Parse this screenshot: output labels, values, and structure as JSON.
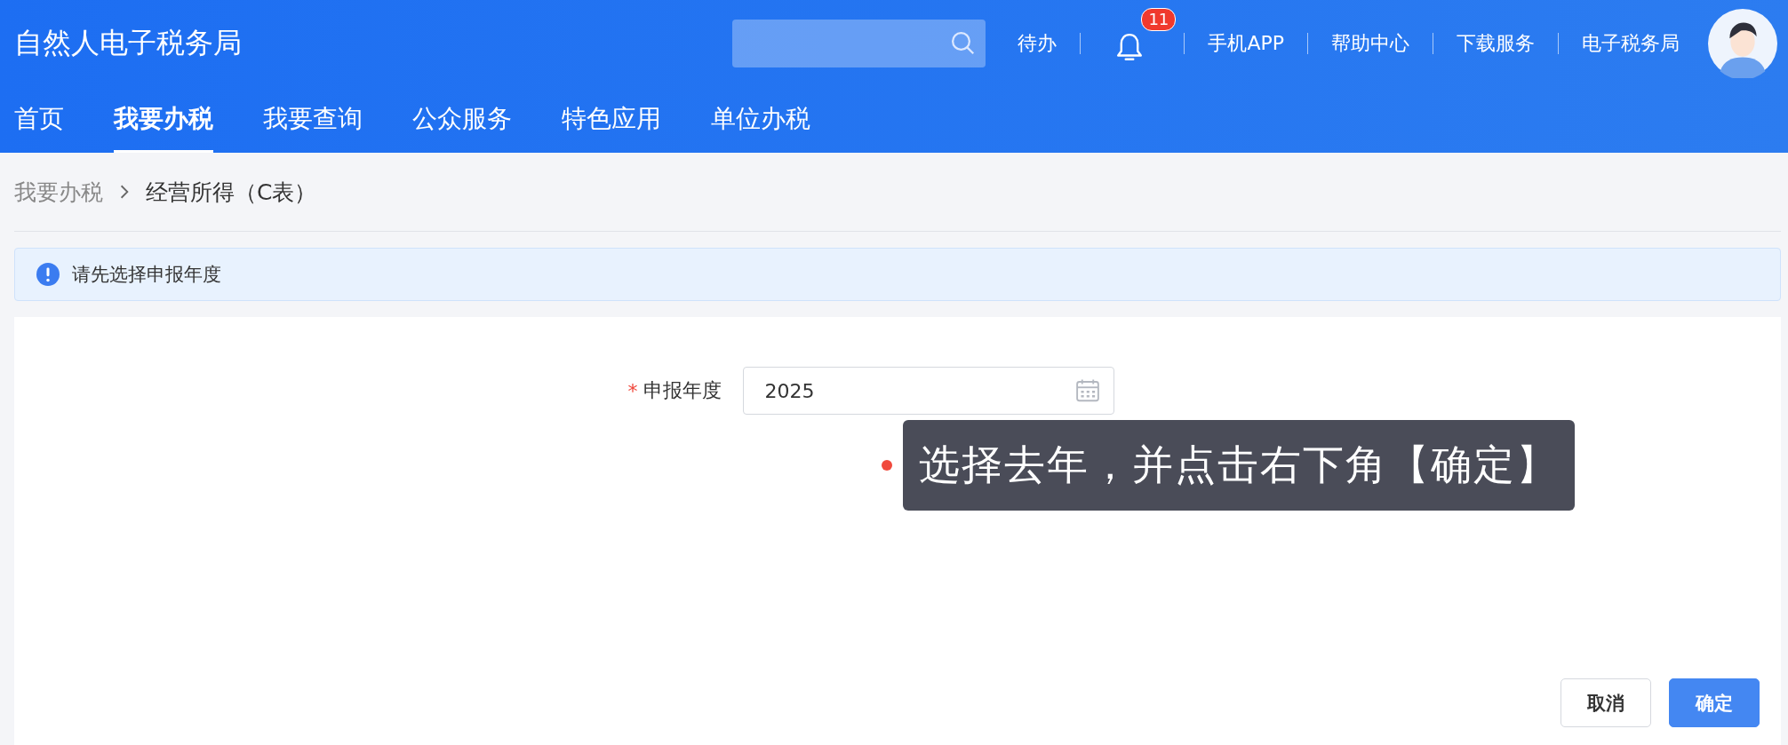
{
  "header": {
    "title": "自然人电子税务局",
    "links": [
      {
        "kind": "text",
        "label": "待办"
      },
      {
        "kind": "bell",
        "badge": "11"
      },
      {
        "kind": "text",
        "label": "手机APP"
      },
      {
        "kind": "text",
        "label": "帮助中心"
      },
      {
        "kind": "text",
        "label": "下载服务"
      },
      {
        "kind": "text",
        "label": "电子税务局"
      }
    ]
  },
  "nav": [
    {
      "label": "首页",
      "selected": false
    },
    {
      "label": "我要办税",
      "selected": true
    },
    {
      "label": "我要查询",
      "selected": false
    },
    {
      "label": "公众服务",
      "selected": false
    },
    {
      "label": "特色应用",
      "selected": false
    },
    {
      "label": "单位办税",
      "selected": false
    }
  ],
  "breadcrumb": [
    "我要办税",
    "经营所得（C表）"
  ],
  "alert": "请先选择申报年度",
  "form": {
    "required_mark": "*",
    "label": "申报年度",
    "value": "2025"
  },
  "guide_tooltip": "选择去年，并点击右下角【确定】",
  "buttons": [
    {
      "label": "取消",
      "kind": "default"
    },
    {
      "label": "确定",
      "kind": "primary"
    }
  ]
}
